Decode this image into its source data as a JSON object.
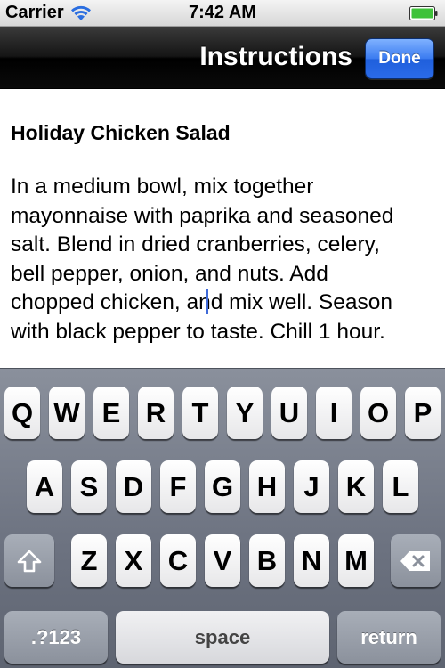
{
  "status_bar": {
    "carrier": "Carrier",
    "time": "7:42 AM"
  },
  "nav_bar": {
    "title": "Instructions",
    "done_label": "Done"
  },
  "recipe": {
    "title": "Holiday Chicken Salad",
    "lines": [
      "In a medium bowl, mix together",
      "mayonnaise with paprika and seasoned",
      "salt. Blend in dried cranberries, celery,",
      "bell pepper, onion, and nuts. Add",
      "chopped chicken, and mix well. Season",
      "with black pepper to taste. Chill 1 hour."
    ]
  },
  "keyboard": {
    "row1": [
      "Q",
      "W",
      "E",
      "R",
      "T",
      "Y",
      "U",
      "I",
      "O",
      "P"
    ],
    "row2": [
      "A",
      "S",
      "D",
      "F",
      "G",
      "H",
      "J",
      "K",
      "L"
    ],
    "row3": [
      "Z",
      "X",
      "C",
      "V",
      "B",
      "N",
      "M"
    ],
    "numbers_label": ".?123",
    "space_label": "space",
    "return_label": "return"
  },
  "icons": {
    "wifi": "wifi-icon",
    "battery": "battery-icon",
    "shift": "shift-icon",
    "backspace": "backspace-icon"
  }
}
